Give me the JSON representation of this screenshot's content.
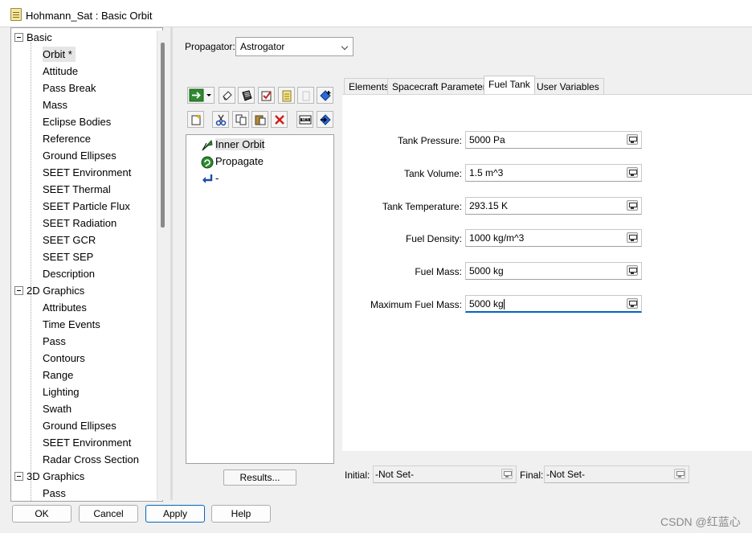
{
  "window": {
    "title": "Hohmann_Sat : Basic Orbit"
  },
  "tree": {
    "groups": [
      {
        "label": "Basic",
        "children": [
          "Orbit *",
          "Attitude",
          "Pass Break",
          "Mass",
          "Eclipse Bodies",
          "Reference",
          "Ground Ellipses",
          "SEET Environment",
          "SEET Thermal",
          "SEET Particle Flux",
          "SEET Radiation",
          "SEET GCR",
          "SEET SEP",
          "Description"
        ]
      },
      {
        "label": "2D Graphics",
        "children": [
          "Attributes",
          "Time Events",
          "Pass",
          "Contours",
          "Range",
          "Lighting",
          "Swath",
          "Ground Ellipses",
          "SEET Environment",
          "Radar Cross Section"
        ]
      },
      {
        "label": "3D Graphics",
        "children": [
          "Pass"
        ]
      }
    ],
    "selected": "Orbit *"
  },
  "propagator": {
    "label": "Propagator:",
    "value": "Astrogator"
  },
  "sequence": {
    "items": [
      {
        "label": "Inner Orbit",
        "icon": "maneuver-icon",
        "selected": true
      },
      {
        "label": "Propagate",
        "icon": "propagate-icon",
        "selected": false
      },
      {
        "label": "-",
        "icon": "return-arrow-icon",
        "selected": false
      }
    ],
    "results_label": "Results..."
  },
  "tabs": [
    {
      "label": "Elements",
      "active": false
    },
    {
      "label": "Spacecraft Parameters",
      "active": false
    },
    {
      "label": "Fuel Tank",
      "active": true
    },
    {
      "label": "User Variables",
      "active": false
    }
  ],
  "fuel_tank": {
    "fields": [
      {
        "label": "Tank Pressure:",
        "value": "5000 Pa"
      },
      {
        "label": "Tank Volume:",
        "value": "1.5 m^3"
      },
      {
        "label": "Tank Temperature:",
        "value": "293.15 K"
      },
      {
        "label": "Fuel Density:",
        "value": "1000 kg/m^3"
      },
      {
        "label": "Fuel Mass:",
        "value": "5000 kg"
      },
      {
        "label": "Maximum Fuel Mass:",
        "value": "5000 kg",
        "focused": true
      }
    ]
  },
  "bottom": {
    "initial_label": "Initial:",
    "initial_value": "-Not Set-",
    "final_label": "Final:",
    "final_value": "-Not Set-"
  },
  "footer": {
    "ok": "OK",
    "cancel": "Cancel",
    "apply": "Apply",
    "help": "Help",
    "watermark": "CSDN @红蓝心"
  }
}
